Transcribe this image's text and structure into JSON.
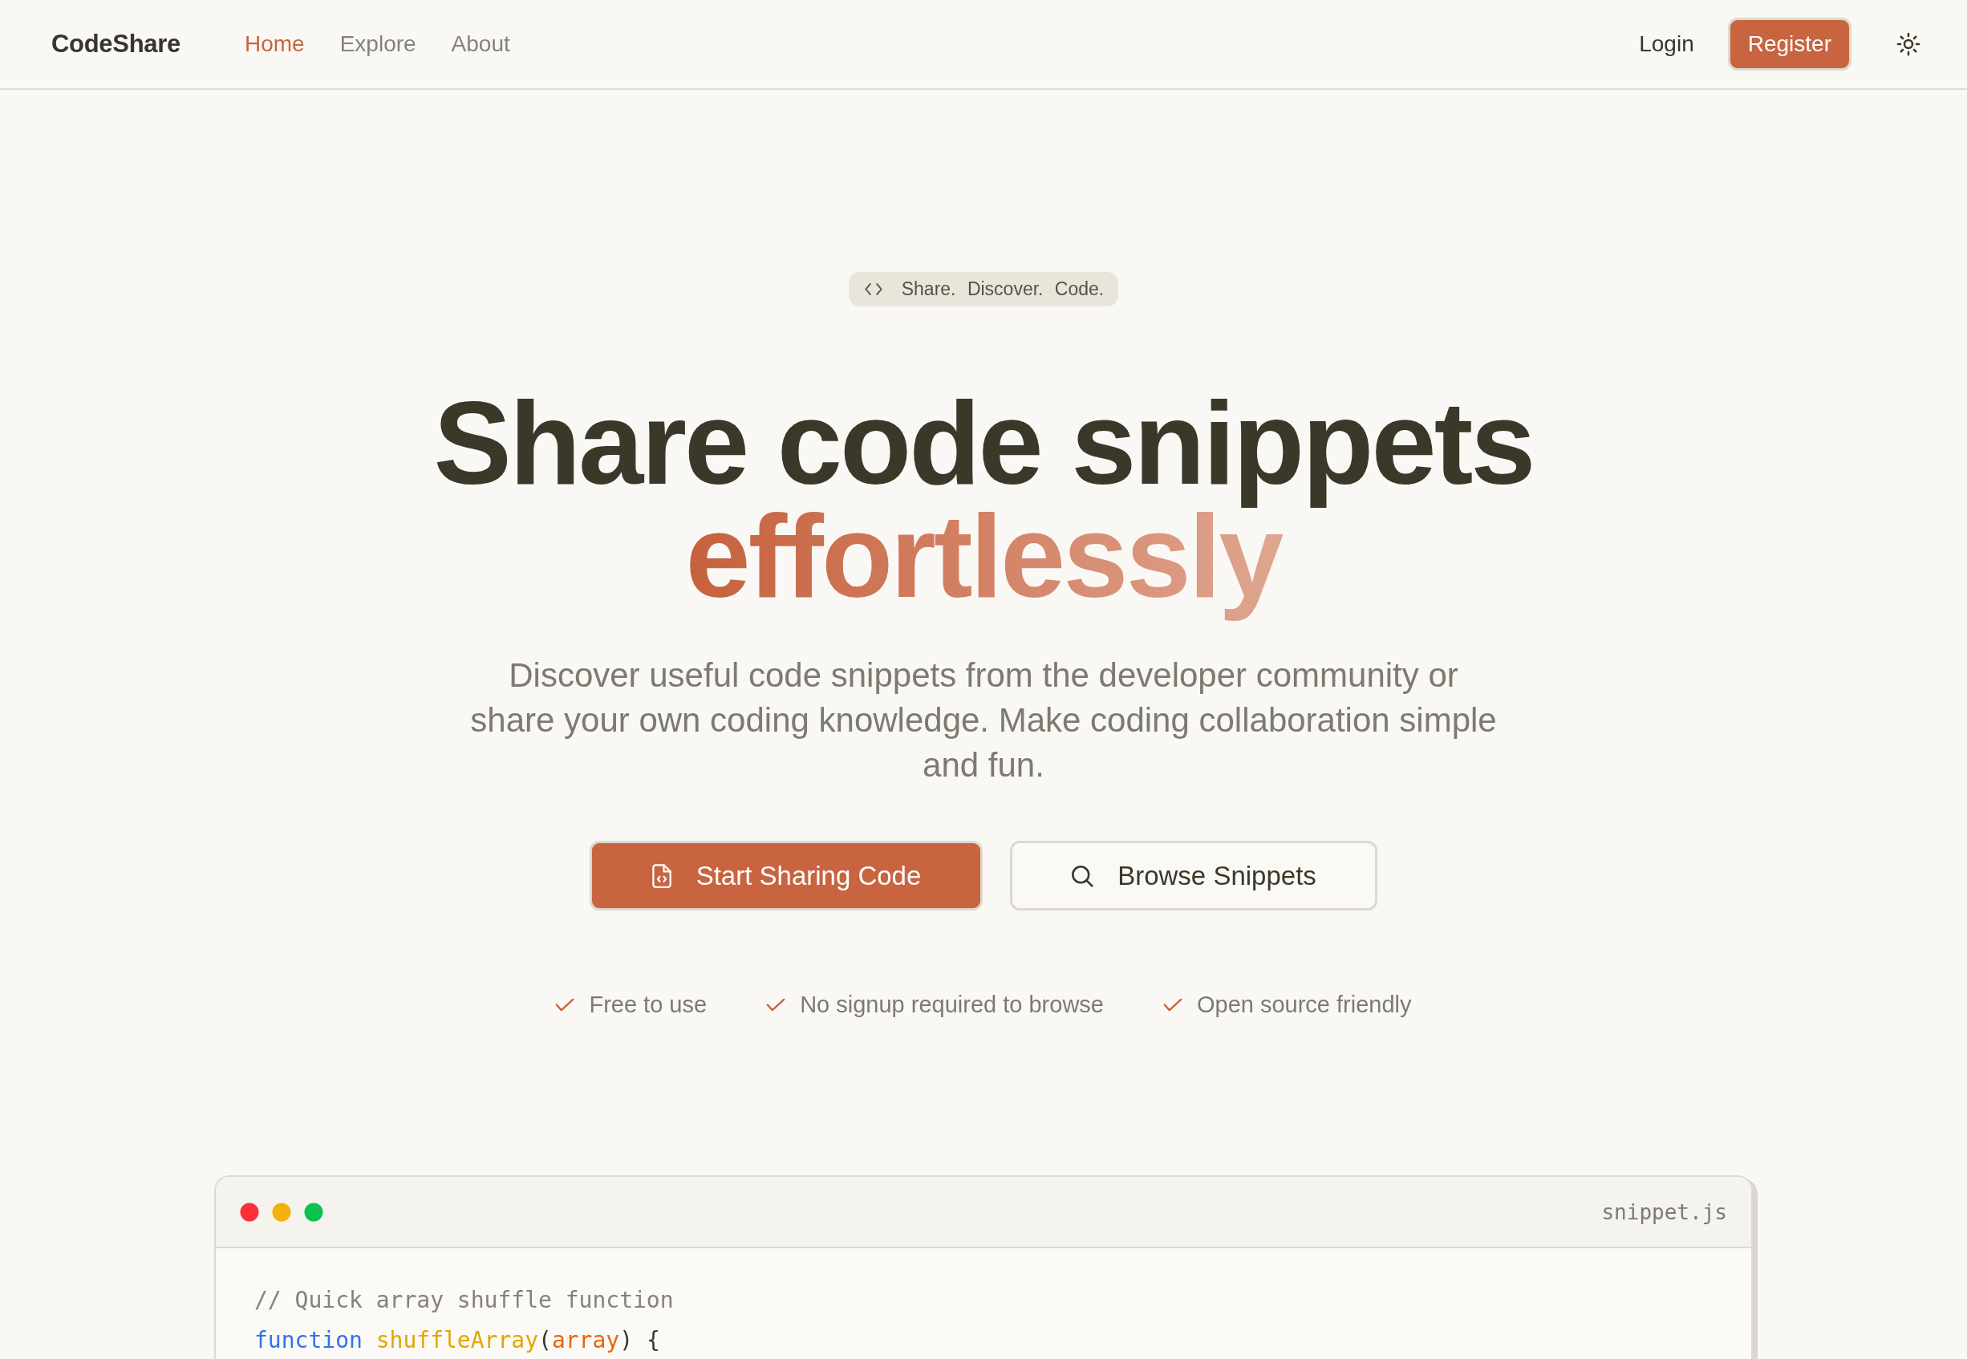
{
  "header": {
    "logo": "CodeShare",
    "nav_links": [
      {
        "label": "Home",
        "selected": true
      },
      {
        "label": "Explore",
        "selected": false
      },
      {
        "label": "About",
        "selected": false
      }
    ],
    "login": "Login",
    "register": "Register"
  },
  "hero": {
    "badge": "Share. Discover. Code.",
    "title": "Share code snippets",
    "title_highlight": "effortlessly",
    "description": "Discover useful code snippets from the developer community or share your own coding knowledge. Make coding collaboration simple and fun.",
    "buttons": [
      {
        "label": "Start Sharing Code",
        "kind": "primary"
      },
      {
        "label": "Browse Snippets",
        "kind": "secondary"
      }
    ],
    "features": [
      "Free to use",
      "No signup required to browse",
      "Open source friendly"
    ]
  },
  "code_window": {
    "filename": "snippet.js",
    "lines": [
      [
        {
          "kind": "comment",
          "text": "// Quick array shuffle function"
        }
      ],
      [
        {
          "kind": "keyword",
          "text": "function"
        },
        {
          "kind": "function",
          "text": " shuffleArray"
        },
        {
          "kind": "plain",
          "text": "("
        },
        {
          "kind": "param",
          "text": "array"
        },
        {
          "kind": "plain",
          "text": ") {"
        }
      ]
    ]
  }
}
